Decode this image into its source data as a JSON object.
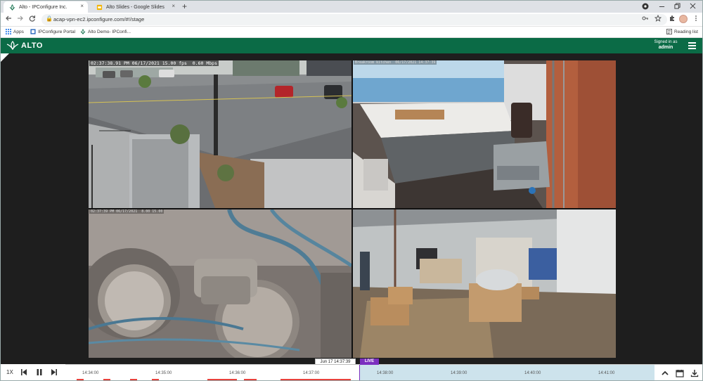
{
  "browser": {
    "tabs": [
      {
        "title": "Alto - IPConfigure Inc.",
        "close": "×"
      },
      {
        "title": "Alto Slides - Google Slides",
        "close": "×"
      }
    ],
    "new_tab": "+",
    "url": "acap-vpn-ec2.ipconfigure.com/#!/stage",
    "bookmarks": [
      "Apps",
      "IPConfigure Portal",
      "Alto Demo- IPConfi..."
    ],
    "reading_list": "Reading list"
  },
  "app": {
    "logo_text": "ALTO",
    "signed_in_label": "Signed in as",
    "user": "admin",
    "brand_color": "#0b6b46"
  },
  "cameras": [
    {
      "osd": "02:37:38.91 PM 06/17/2021 15.00 fps  0.60 Mbps"
    },
    {
      "osd": "Breakroom kitchen  06/17/2021 14:37:39"
    },
    {
      "osd": "02:37:39 PM 06/17/2021  8.00 15.00"
    },
    {
      "osd": ""
    }
  ],
  "timeline": {
    "speed": "1X",
    "current_time": "Jun 17 14:37:39",
    "live_label": "LIVE",
    "ticks": [
      "14:34:00",
      "14:35:00",
      "14:36:00",
      "14:37:00",
      "14:38:00",
      "14:39:00",
      "14:40:00",
      "14:41:00"
    ],
    "live_color": "#7b2fbf",
    "recording_color": "#e8413c"
  }
}
